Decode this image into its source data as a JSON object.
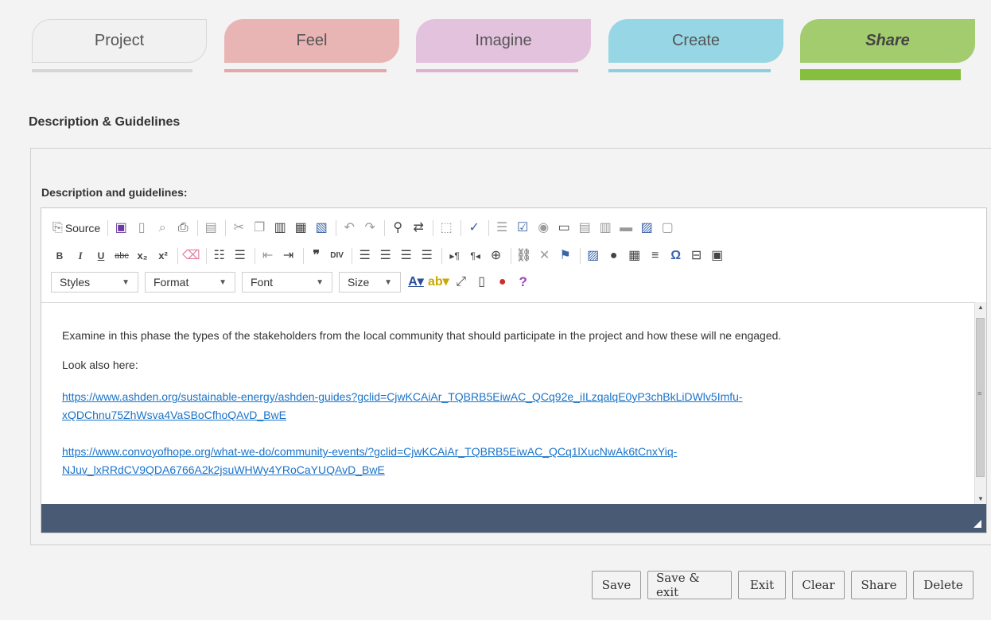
{
  "tabs": [
    {
      "label": "Project"
    },
    {
      "label": "Feel"
    },
    {
      "label": "Imagine"
    },
    {
      "label": "Create"
    },
    {
      "label": "Share"
    }
  ],
  "section_title": "Description & Guidelines",
  "field_label": "Description and guidelines:",
  "toolbar": {
    "source_label": "Source",
    "bold": "B",
    "italic": "I",
    "underline": "U",
    "strike": "abc",
    "styles_label": "Styles",
    "format_label": "Format",
    "font_label": "Font",
    "size_label": "Size"
  },
  "content": {
    "paragraph1": "Examine in this phase the types of the stakeholders from the local community that should participate in the project and how these will ne engaged.",
    "paragraph2": "Look also here:",
    "link1_line1": "https://www.ashden.org/sustainable-energy/ashden-guides?gclid=CjwKCAiAr_TQBRB5EiwAC_QCq92e_iILzqalqE0yP3chBkLiDWlv5Imfu-",
    "link1_line2": "xQDChnu75ZhWsva4VaSBoCfhoQAvD_BwE",
    "link2_line1": "https://www.convoyofhope.org/what-we-do/community-events/?gclid=CjwKCAiAr_TQBRB5EiwAC_QCq1lXucNwAk6tCnxYiq-",
    "link2_line2": "NJuv_lxRRdCV9QDA6766A2k2jsuWHWy4YRoCaYUQAvD_BwE"
  },
  "actions": {
    "save": "Save",
    "save_exit": "Save & exit",
    "exit": "Exit",
    "clear": "Clear",
    "share": "Share",
    "delete": "Delete"
  },
  "colors": {
    "tab_project": "#f1f1f1",
    "tab_feel": "#e8b4b4",
    "tab_imagine": "#e3c2dd",
    "tab_create": "#97d6e4",
    "tab_share": "#a3cc6e",
    "active_underline": "#86bf3f",
    "status_bar": "#485a74",
    "link": "#1a73c9"
  }
}
